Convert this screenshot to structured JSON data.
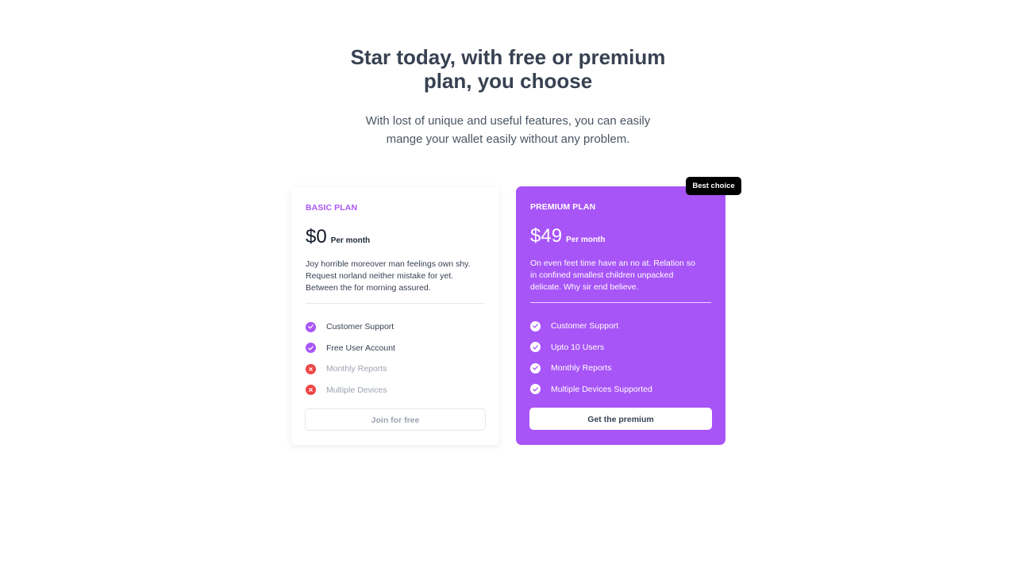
{
  "hero": {
    "title_line1": "Star today, with free or premium",
    "title_line2": "plan, you choose",
    "subtitle_line1": "With lost of unique and useful features, you can easily",
    "subtitle_line2": "mange your wallet easily without any problem."
  },
  "colors": {
    "accent": "#a855f7",
    "danger": "#ef4444",
    "badge": "#000000"
  },
  "plans": {
    "basic": {
      "name": "BASIC PLAN",
      "price": "$0",
      "period": "Per month",
      "desc_line1": "Joy horrible moreover man feelings own shy.",
      "desc_line2": "Request norland neither mistake for yet.",
      "desc_line3": "Between the for morning assured.",
      "features": [
        {
          "label": "Customer Support",
          "included": true,
          "icon": "check-icon"
        },
        {
          "label": "Free User Account",
          "included": true,
          "icon": "check-icon"
        },
        {
          "label": "Monthly Reports",
          "included": false,
          "icon": "x-icon"
        },
        {
          "label": "Multiple Devices",
          "included": false,
          "icon": "x-icon"
        }
      ],
      "cta": "Join for free"
    },
    "premium": {
      "badge": "Best choice",
      "name": "PREMIUM PLAN",
      "price": "$49",
      "period": "Per month",
      "desc_line1": "On even feet time have an no at. Relation so",
      "desc_line2": "in confined smallest children unpacked",
      "desc_line3": "delicate. Why sir end believe.",
      "features": [
        {
          "label": "Customer Support",
          "included": true,
          "icon": "check-icon"
        },
        {
          "label": "Upto 10 Users",
          "included": true,
          "icon": "check-icon"
        },
        {
          "label": "Monthly Reports",
          "included": true,
          "icon": "check-icon"
        },
        {
          "label": "Multiple Devices Supported",
          "included": true,
          "icon": "check-icon"
        }
      ],
      "cta": "Get the premium"
    }
  }
}
